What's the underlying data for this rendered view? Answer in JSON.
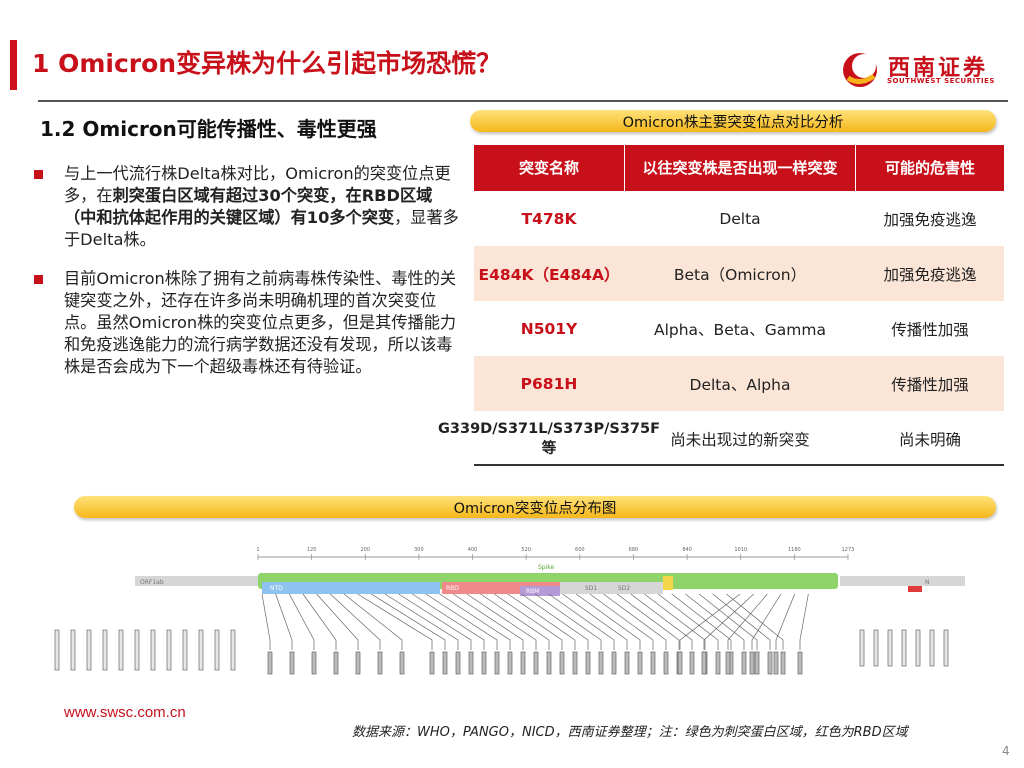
{
  "header": {
    "title": "1 Omicron变异株为什么引起市场恐慌？",
    "logo_cn": "西南证券",
    "logo_en": "SOUTHWEST SECURITIES"
  },
  "subtitle": "1.2 Omicron可能传播性、毒性更强",
  "bullets": [
    {
      "parts": [
        {
          "t": "与上一代流行株Delta株对比，Omicron的突变位点更多，在",
          "b": false
        },
        {
          "t": "刺突蛋白区域有超过30个突变，在RBD区域（中和抗体起作用的关键区域）有10多个突变",
          "b": true
        },
        {
          "t": "，显著多于Delta株。",
          "b": false
        }
      ]
    },
    {
      "parts": [
        {
          "t": "目前Omicron株除了拥有之前病毒株传染性、毒性的关键突变之外，还存在许多尚未明确机理的首次突变位点。虽然Omicron株的突变位点更多，但是其传播能力和免疫逃逸能力的流行病学数据还没有发现，所以该毒株是否会成为下一个超级毒株还有待验证。",
          "b": false
        }
      ]
    }
  ],
  "table": {
    "banner": "Omicron株主要突变位点对比分析",
    "headers": [
      "突变名称",
      "以往突变株是否出现一样突变",
      "可能的危害性"
    ],
    "rows": [
      {
        "name": "T478K",
        "prior": "Delta",
        "harm": "加强免疫逃逸"
      },
      {
        "name": "E484K（E484A）",
        "prior": "Beta（Omicron）",
        "harm": "加强免疫逃逸"
      },
      {
        "name": "N501Y",
        "prior": "Alpha、Beta、Gamma",
        "harm": "传播性加强"
      },
      {
        "name": "P681H",
        "prior": "Delta、Alpha",
        "harm": "传播性加强"
      },
      {
        "name": "G339D/S371L/S373P/S375F等",
        "prior": "尚未出现过的新突变",
        "harm": "尚未明确"
      }
    ]
  },
  "diagram": {
    "banner": "Omicron突变位点分布图",
    "ruler_ticks": [
      "1",
      "120",
      "200",
      "300",
      "400",
      "520",
      "600",
      "680",
      "840",
      "1010",
      "1180",
      "1273"
    ],
    "spike_label": "Spike",
    "orf_label": "ORF1ab",
    "n_label": "N",
    "domain_labels": [
      "NTD",
      "RBD",
      "RBM",
      "SD1",
      "SD2"
    ],
    "colors": {
      "spike": "#8fd46a",
      "rbd": "#f08a8a",
      "ntd": "#8dc3ee",
      "rbm": "#b59ad8",
      "sd": "#f5d54a",
      "gray": "#d6d6d6"
    }
  },
  "footer": {
    "url": "www.swsc.com.cn",
    "source": "数据来源：WHO，PANGO，NICD，西南证券整理；注：绿色为刺突蛋白区域，红色为RBD区域",
    "page": "4"
  }
}
